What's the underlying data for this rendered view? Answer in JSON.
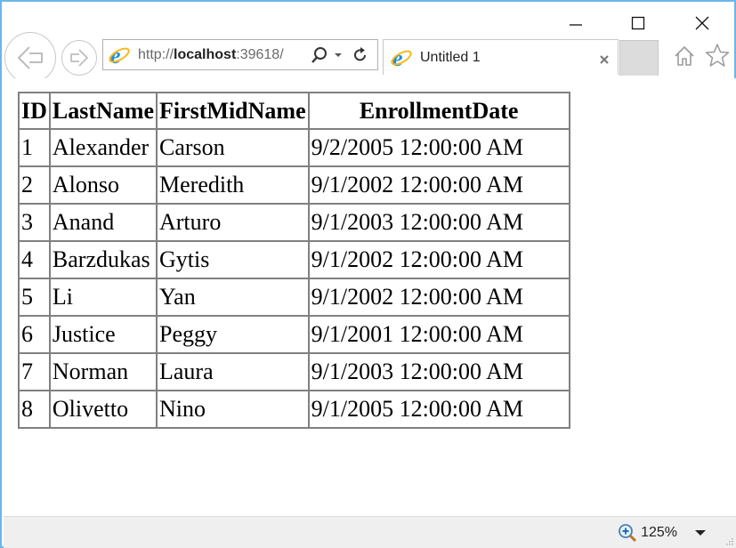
{
  "window": {
    "caption_buttons": [
      "minimize",
      "maximize",
      "close"
    ]
  },
  "toolbar": {
    "back_icon": "back-arrow-icon",
    "forward_icon": "forward-arrow-icon",
    "address": {
      "protocol": "http://",
      "host": "localhost",
      "rest": ":39618/"
    },
    "search_icon": "search-icon",
    "dropdown_icon": "chevron-down-icon",
    "refresh_icon": "refresh-icon",
    "home_icon": "home-icon",
    "favorites_icon": "star-icon"
  },
  "tabs": [
    {
      "title": "Untitled 1",
      "active": true
    }
  ],
  "table": {
    "headers": [
      "ID",
      "LastName",
      "FirstMidName",
      "EnrollmentDate"
    ],
    "rows": [
      [
        "1",
        "Alexander",
        "Carson",
        "9/2/2005 12:00:00 AM"
      ],
      [
        "2",
        "Alonso",
        "Meredith",
        "9/1/2002 12:00:00 AM"
      ],
      [
        "3",
        "Anand",
        "Arturo",
        "9/1/2003 12:00:00 AM"
      ],
      [
        "4",
        "Barzdukas",
        "Gytis",
        "9/1/2002 12:00:00 AM"
      ],
      [
        "5",
        "Li",
        "Yan",
        "9/1/2002 12:00:00 AM"
      ],
      [
        "6",
        "Justice",
        "Peggy",
        "9/1/2001 12:00:00 AM"
      ],
      [
        "7",
        "Norman",
        "Laura",
        "9/1/2003 12:00:00 AM"
      ],
      [
        "8",
        "Olivetto",
        "Nino",
        "9/1/2005 12:00:00 AM"
      ]
    ]
  },
  "statusbar": {
    "zoom_level": "125%"
  },
  "colors": {
    "window_border": "#6cb6ea",
    "ie_blue": "#1e8fd8",
    "ie_ring": "#f5b91e"
  }
}
